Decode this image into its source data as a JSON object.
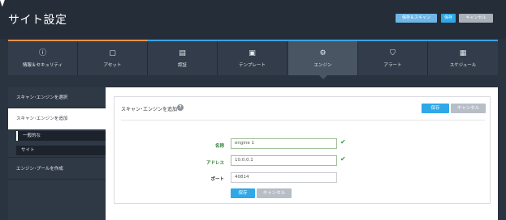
{
  "header": {
    "title": "サイト設定",
    "buttons": {
      "scan": "保存＆スキャン",
      "save": "保存",
      "cancel": "キャンセル"
    }
  },
  "tabs": [
    {
      "icon": "ⓘ",
      "label": "情報＆セキュリティ"
    },
    {
      "icon": "▢",
      "label": "アセット"
    },
    {
      "icon": "▤",
      "label": "認証"
    },
    {
      "icon": "▣",
      "label": "テンプレート"
    },
    {
      "icon": "⚙",
      "label": "エンジン"
    },
    {
      "icon": "⛉",
      "label": "アラート"
    },
    {
      "icon": "▦",
      "label": "スケジュール"
    }
  ],
  "sidebar": {
    "select": "スキャン･エンジンを選択",
    "add": "スキャン･エンジンを追加",
    "sub_general": "一般的な",
    "sub_site": "サイト",
    "pool": "エンジン･プールを作成"
  },
  "card": {
    "title": "スキャン･エンジンを追加",
    "help": "?",
    "save": "保存",
    "cancel": "キャンセル"
  },
  "form": {
    "name_label": "名称",
    "name_value": "engine 1",
    "address_label": "アドレス",
    "address_value": "10.0.0.1",
    "port_label": "ポート",
    "port_value": "40814",
    "check_mark": "✔",
    "save": "保存",
    "cancel": "キャンセル"
  }
}
